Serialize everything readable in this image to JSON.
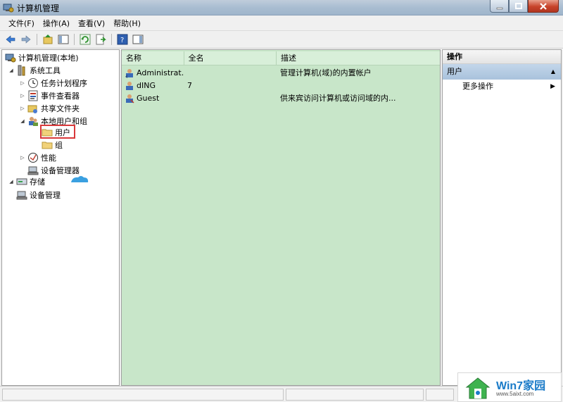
{
  "window": {
    "title": "计算机管理"
  },
  "menu": [
    "文件(F)",
    "操作(A)",
    "查看(V)",
    "帮助(H)"
  ],
  "tree": [
    {
      "label": "计算机管理(本地)",
      "expander": "",
      "icon": "computer-management-icon"
    },
    {
      "label": "系统工具",
      "expander": "◢",
      "icon": "system-tools-icon"
    },
    {
      "label": "任务计划程序",
      "expander": "▷",
      "icon": "task-scheduler-icon"
    },
    {
      "label": "事件查看器",
      "expander": "▷",
      "icon": "event-viewer-icon"
    },
    {
      "label": "共享文件夹",
      "expander": "▷",
      "icon": "shared-folders-icon"
    },
    {
      "label": "本地用户和组",
      "expander": "◢",
      "icon": "local-users-groups-icon"
    },
    {
      "label": "用户",
      "expander": "",
      "icon": "folder-icon"
    },
    {
      "label": "组",
      "expander": "",
      "icon": "folder-icon"
    },
    {
      "label": "性能",
      "expander": "▷",
      "icon": "performance-icon"
    },
    {
      "label": "设备管理器",
      "expander": "",
      "icon": "device-manager-icon"
    },
    {
      "label": "存储",
      "expander": "◢",
      "icon": "storage-icon"
    },
    {
      "label": "设备管理",
      "expander": "",
      "icon": "device-management-icon"
    }
  ],
  "list": {
    "columns": [
      "名称",
      "全名",
      "描述"
    ],
    "rows": [
      {
        "name": "Administrat...",
        "fullname": "",
        "description": "管理计算机(域)的内置帐户"
      },
      {
        "name": "dING",
        "fullname": "7",
        "description": ""
      },
      {
        "name": "Guest",
        "fullname": "",
        "description": "供来宾访问计算机或访问域的内..."
      }
    ]
  },
  "actions": {
    "header": "操作",
    "section": "用户",
    "item": "更多操作"
  },
  "watermark": {
    "brand": "Win7家园",
    "url": "www.5aixt.com"
  },
  "colors": {
    "list_bg": "#c8e6c9",
    "selection_box": "#d9383a",
    "action_section": "#b7cde3"
  }
}
